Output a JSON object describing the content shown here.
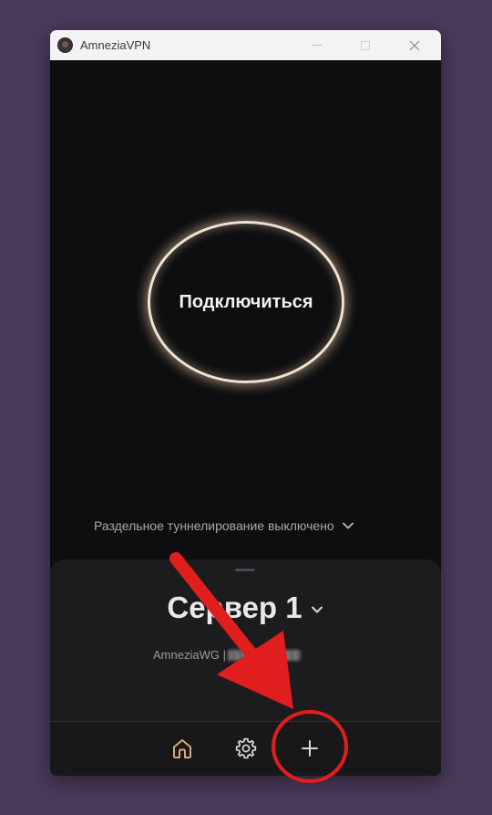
{
  "window": {
    "title": "AmneziaVPN"
  },
  "main": {
    "connect_label": "Подключиться",
    "split_tunneling_label": "Раздельное туннелирование выключено"
  },
  "server": {
    "name": "Сервер 1",
    "protocol_prefix": "AmneziaWG | "
  },
  "nav": {
    "items": [
      {
        "icon": "home-icon",
        "active": true
      },
      {
        "icon": "gear-icon",
        "active": false
      },
      {
        "icon": "plus-icon",
        "active": false
      }
    ]
  },
  "colors": {
    "background": "#4b3a5a",
    "app_bg": "#0e0e10",
    "sheet_bg": "#1c1c1f",
    "accent": "#d7a87a",
    "ring": "#efe2d2",
    "annotation": "#e01e1e"
  }
}
